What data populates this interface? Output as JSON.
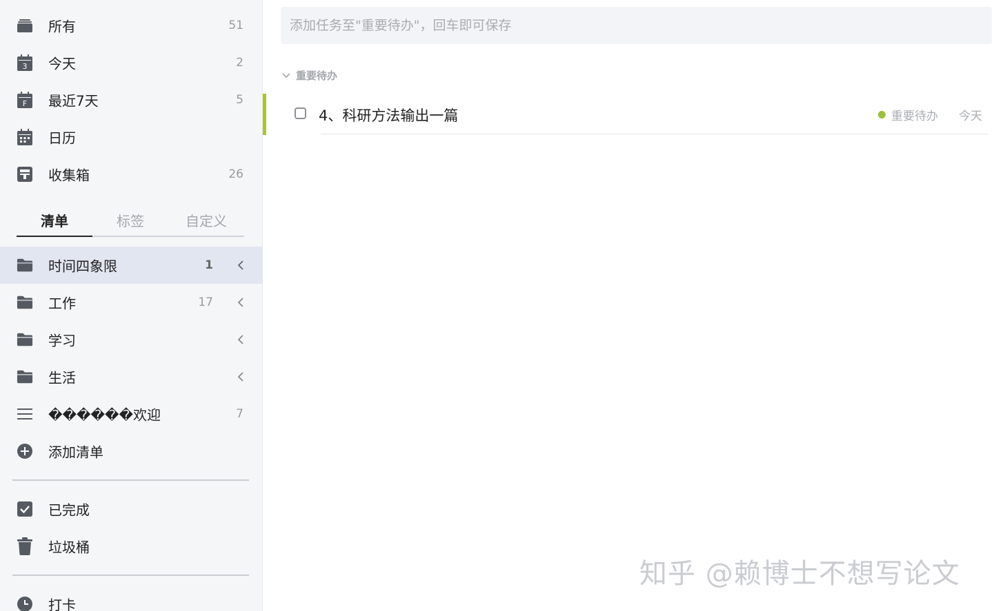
{
  "smart_lists": [
    {
      "label": "所有",
      "count": "51",
      "icon": "inbox-stack-icon"
    },
    {
      "label": "今天",
      "count": "2",
      "icon": "calendar-today-icon",
      "icon_text": "3"
    },
    {
      "label": "最近7天",
      "count": "5",
      "icon": "calendar-week-icon",
      "icon_text": "F"
    },
    {
      "label": "日历",
      "count": "",
      "icon": "calendar-grid-icon"
    },
    {
      "label": "收集箱",
      "count": "26",
      "icon": "collect-box-icon"
    }
  ],
  "tabs": [
    {
      "label": "清单",
      "active": true
    },
    {
      "label": "标签",
      "active": false
    },
    {
      "label": "自定义",
      "active": false
    }
  ],
  "lists": [
    {
      "label": "时间四象限",
      "count": "1",
      "icon": "folder-icon",
      "active": true
    },
    {
      "label": "工作",
      "count": "17",
      "icon": "folder-icon"
    },
    {
      "label": "学习",
      "count": "",
      "icon": "folder-icon"
    },
    {
      "label": "生活",
      "count": "",
      "icon": "folder-icon"
    },
    {
      "label": "������欢迎",
      "count": "7",
      "icon": "list-lines-icon"
    }
  ],
  "add_list": {
    "label": "添加清单",
    "icon": "plus-circle-icon"
  },
  "footer_items": [
    {
      "label": "已完成",
      "icon": "checkbox-checked-icon"
    },
    {
      "label": "垃圾桶",
      "icon": "trash-icon"
    },
    {
      "label": "打卡",
      "icon": "clock-icon"
    }
  ],
  "main": {
    "add_task_placeholder": "添加任务至\"重要待办\"，回车即可保存",
    "section_title": "重要待办",
    "tasks": [
      {
        "title": "4、科研方法输出一篇",
        "tag": "重要待办",
        "due": "今天",
        "priority_color": "#a8c23c",
        "tag_color": "#9bc13a"
      }
    ]
  },
  "watermark": "知乎 @赖博士不想写论文",
  "colors": {
    "sidebar_bg": "#f5f6f8",
    "active_item_bg": "#e2e6f1",
    "icon": "#555a62"
  }
}
